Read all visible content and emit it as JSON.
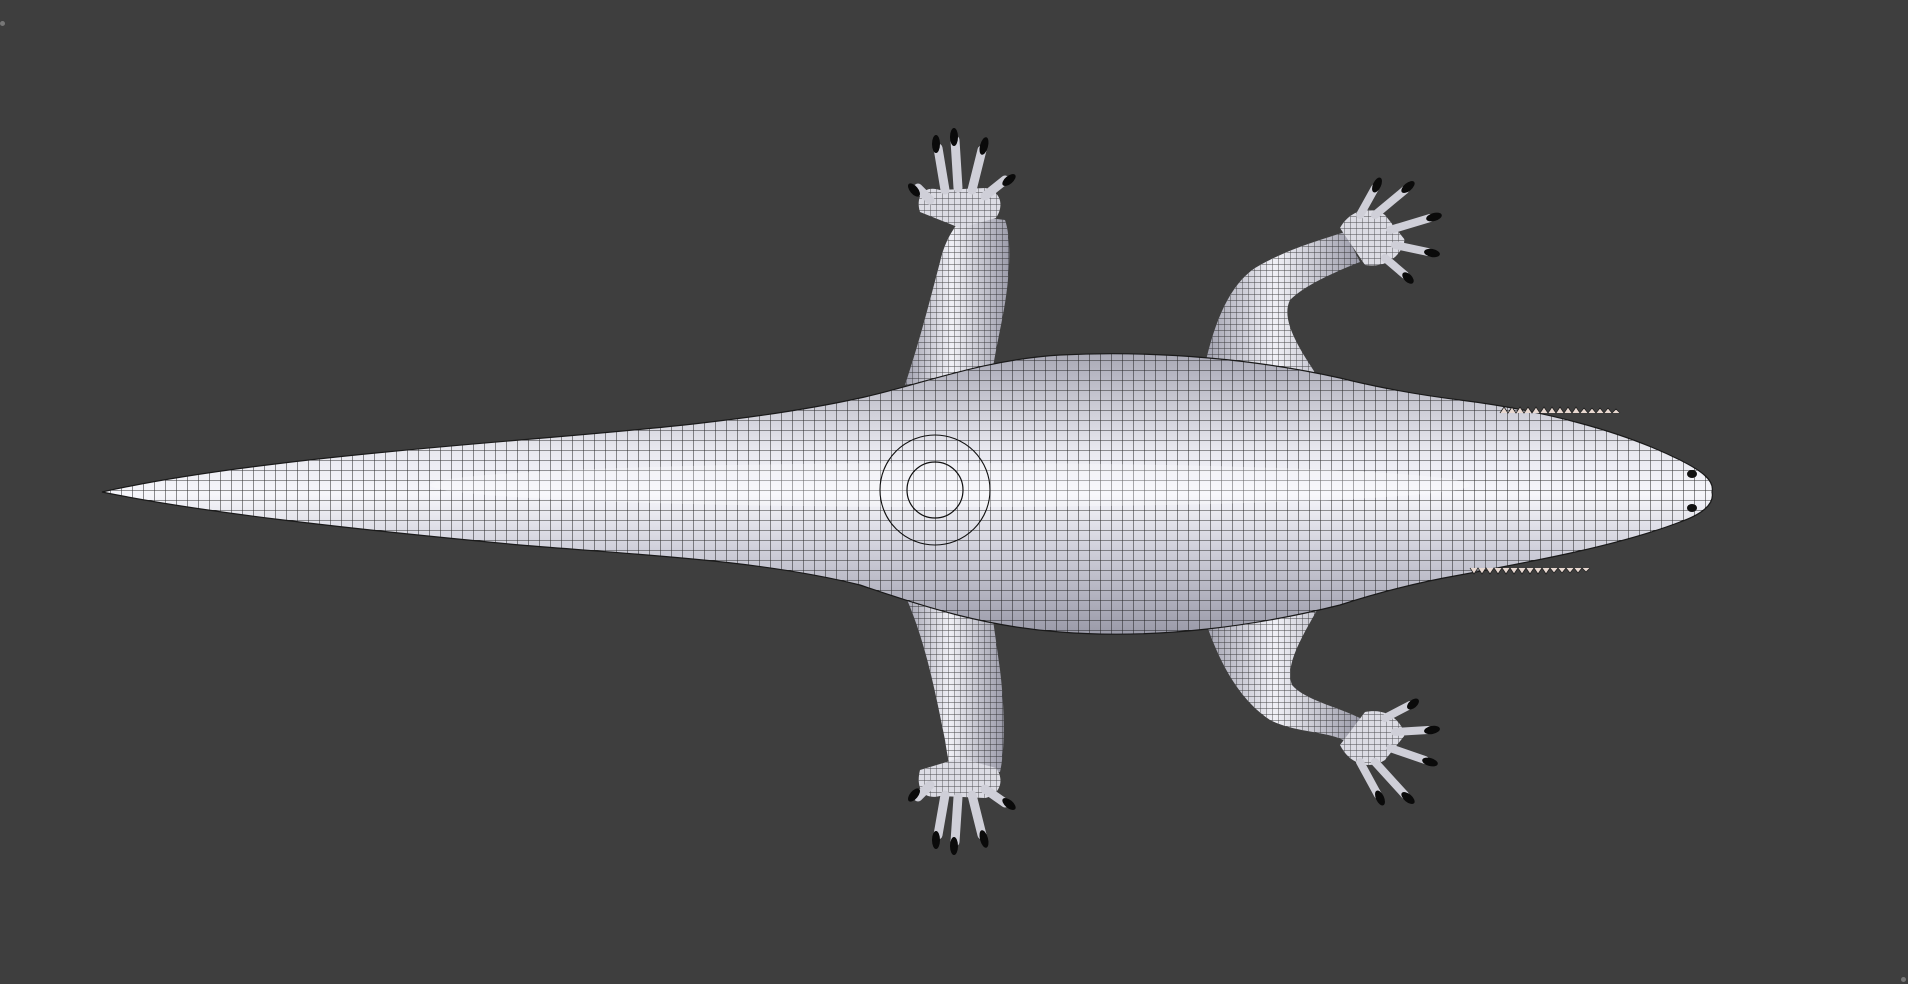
{
  "viewport": {
    "background_color": "#3e3e3e",
    "mesh_color": "#c9c9d3",
    "wire_color": "#111111",
    "claw_color": "#0a0a0a",
    "shading": "solid-with-wireframe-overlay",
    "view": "top"
  },
  "model": {
    "subject": "crocodile",
    "icon": "crocodile-mesh-icon"
  },
  "widgets": {
    "area_split_top_left": "corner-split-icon",
    "area_split_bottom_right": "corner-split-icon"
  }
}
